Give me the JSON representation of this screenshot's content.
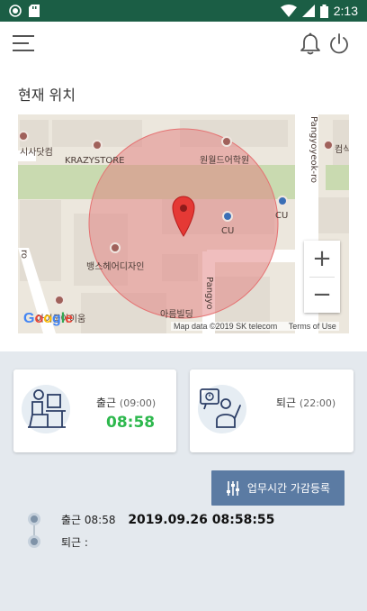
{
  "status_bar": {
    "time": "2:13",
    "icons": [
      "app-icon",
      "sd-card-icon",
      "wifi-icon",
      "signal-icon",
      "battery-icon"
    ],
    "background": "#1b5e45"
  },
  "app_bar": {
    "icons": [
      "menu-icon",
      "bell-icon",
      "power-icon"
    ]
  },
  "location": {
    "title": "현재 위치"
  },
  "map": {
    "labels": {
      "sadakeom": "시사닷컴",
      "krazystore": "KRAZYSTORE",
      "academy": "원월드어학원",
      "cu_center": "CU",
      "cu_right": "CU",
      "hair": "뱅스헤어디자인",
      "road_right": "Pangyoyeok-ro",
      "road_bottom": "Pangyo",
      "road_bottom2": "yeok-ro",
      "store_right": "컴식",
      "building": "아름빌딩",
      "bottom_left": "아이쿱아이움",
      "left_road": "ro"
    },
    "zoom_in": "+",
    "zoom_out": "−",
    "google": "Google",
    "attribution": "Map data ©2019 SK telecom",
    "terms": "Terms of Use",
    "marker_color": "#e53935",
    "radius_color": "#e57373"
  },
  "checkin_card": {
    "label": "출근",
    "scheduled": "(09:00)",
    "actual": "08:58"
  },
  "checkout_card": {
    "label": "퇴근",
    "scheduled": "(22:00)"
  },
  "adjust_button": {
    "label": "업무시간 가감등록"
  },
  "timeline": {
    "checkin_label": "출근 08:58",
    "checkin_stamp": "2019.09.26 08:58:55",
    "checkout_label": "퇴근 :"
  }
}
